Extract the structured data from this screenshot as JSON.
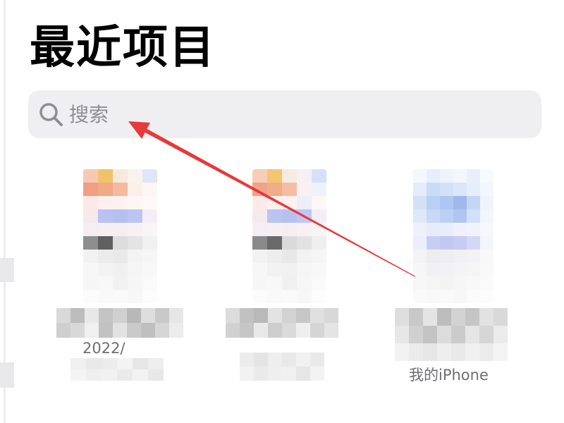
{
  "header": {
    "title": "最近项目"
  },
  "search": {
    "placeholder": "搜索",
    "icon": "search-icon"
  },
  "files": [
    {
      "detail": "2022/"
    },
    {
      "detail": ""
    },
    {
      "detail": "我的iPhone"
    }
  ],
  "colors": {
    "title": "#000000",
    "search_background": "#efeff1",
    "search_text": "#8e8e93",
    "detail_text": "#6e6e73",
    "annotation_arrow": "#e8393b"
  }
}
